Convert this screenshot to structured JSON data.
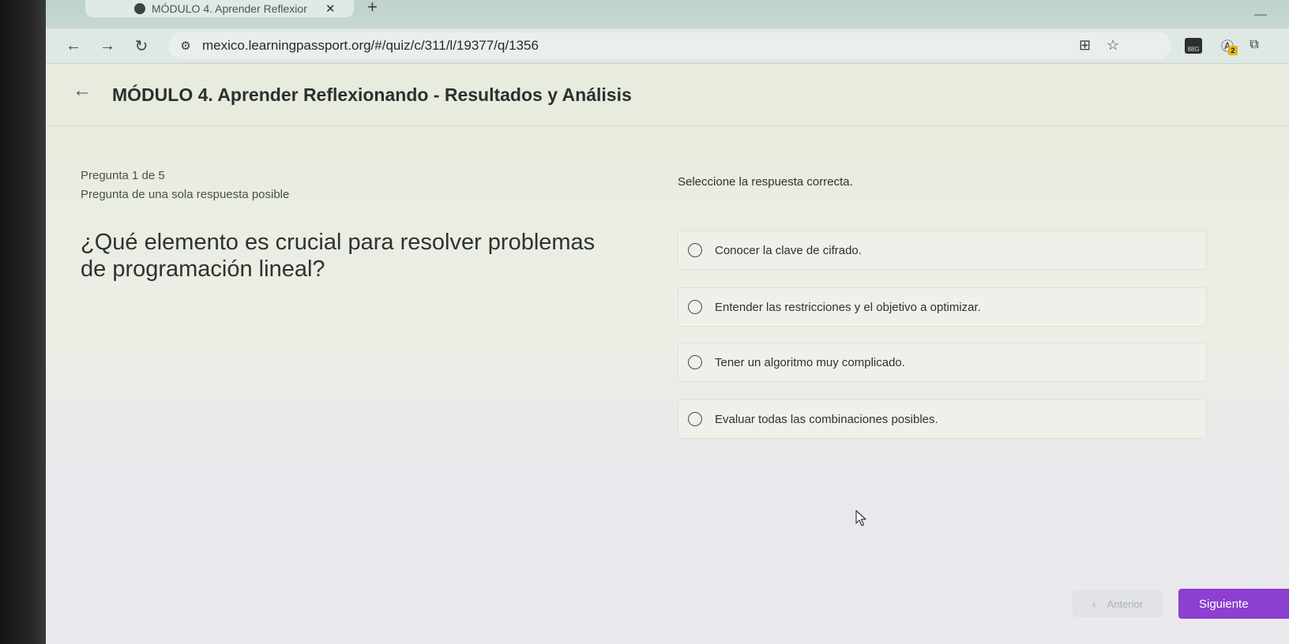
{
  "browser": {
    "tab_title": "MÓDULO 4. Aprender Reflexior",
    "tab_close_glyph": "✕",
    "new_tab_glyph": "+",
    "minimize_glyph": "—",
    "url": "mexico.learningpassport.org/#/quiz/c/311/l/19377/q/1356",
    "extension_badge_count": "2",
    "extension_badge_text": "88G"
  },
  "header": {
    "back_glyph": "←",
    "title": "MÓDULO 4. Aprender Reflexionando - Resultados y Análisis"
  },
  "question": {
    "counter": "Pregunta 1 de 5",
    "type": "Pregunta de una sola respuesta posible",
    "text": "¿Qué elemento es crucial para resolver problemas de programación lineal?",
    "instruction": "Seleccione la respuesta correcta.",
    "options": [
      {
        "label": "Conocer la clave de cifrado."
      },
      {
        "label": "Entender las restricciones y el objetivo a optimizar."
      },
      {
        "label": "Tener un algoritmo muy complicado."
      },
      {
        "label": "Evaluar todas las combinaciones posibles."
      }
    ]
  },
  "navigation": {
    "prev_glyph": "‹",
    "prev_label": "Anterior",
    "next_label": "Siguiente"
  },
  "colors": {
    "accent": "#8c3fd0"
  }
}
